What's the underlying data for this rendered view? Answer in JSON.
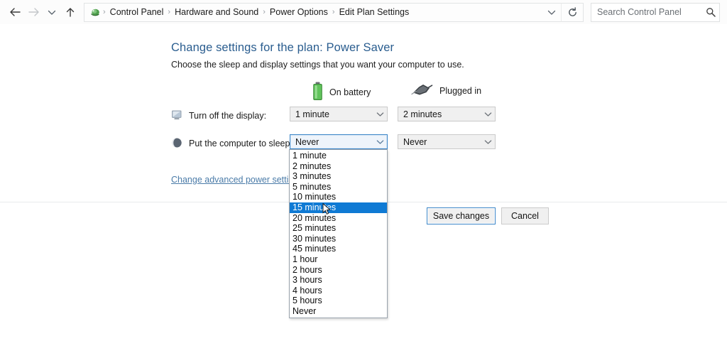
{
  "addressbar": {
    "nav": {
      "back_title": "Back",
      "forward_title": "Forward",
      "recent_title": "Recent locations",
      "up_title": "Up one level"
    },
    "app_icon": "control-panel-icon",
    "breadcrumbs": [
      "Control Panel",
      "Hardware and Sound",
      "Power Options",
      "Edit Plan Settings"
    ],
    "separator": "›",
    "dropdown_icon": "chevron-down-icon",
    "refresh_icon": "refresh-icon",
    "search": {
      "placeholder": "Search Control Panel",
      "value": "",
      "icon": "search-icon"
    }
  },
  "page": {
    "title": "Change settings for the plan: Power Saver",
    "subtitle": "Choose the sleep and display settings that you want your computer to use.",
    "columns": [
      {
        "label": "On battery",
        "icon": "battery-icon"
      },
      {
        "label": "Plugged in",
        "icon": "power-plug-icon"
      }
    ],
    "rows": [
      {
        "label": "Turn off the display:",
        "icon": "monitor-icon",
        "on_battery": "1 minute",
        "plugged_in": "2 minutes"
      },
      {
        "label": "Put the computer to sleep:",
        "icon": "moon-sleep-icon",
        "on_battery": "Never",
        "plugged_in": "Never"
      }
    ],
    "advanced_link": "Change advanced power settings",
    "buttons": {
      "save": "Save changes",
      "cancel": "Cancel"
    }
  },
  "dropdown": {
    "open_for": "put-the-computer-to-sleep-on-battery",
    "selected_value": "Never",
    "highlighted": "15 minutes",
    "options": [
      "1 minute",
      "2 minutes",
      "3 minutes",
      "5 minutes",
      "10 minutes",
      "15 minutes",
      "20 minutes",
      "25 minutes",
      "30 minutes",
      "45 minutes",
      "1 hour",
      "2 hours",
      "3 hours",
      "4 hours",
      "5 hours",
      "Never"
    ]
  },
  "colors": {
    "accent_blue": "#0f7ad4",
    "title_blue": "#2a5d8f",
    "link_blue": "#4a7ba8",
    "battery_green": "#49b04a",
    "focus_border": "#3c86c8"
  }
}
